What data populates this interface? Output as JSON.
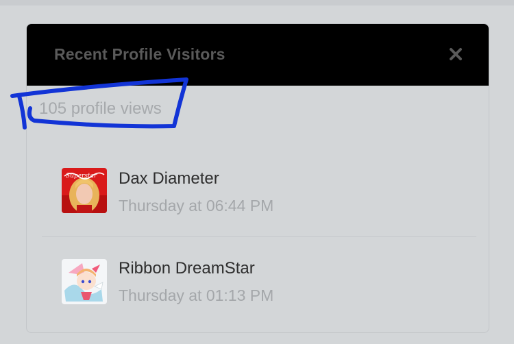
{
  "panel": {
    "title": "Recent Profile Visitors",
    "close_glyph": "✖",
    "views_text": "105 profile views"
  },
  "visitors": [
    {
      "name": "Dax Diameter",
      "time": "Thursday at 06:44 PM",
      "avatar_text": "Superstar",
      "avatar_icon": "superstar-album-cover"
    },
    {
      "name": "Ribbon DreamStar",
      "time": "Thursday at 01:13 PM",
      "avatar_icon": "anime-character-avatar"
    }
  ],
  "colors": {
    "page_bg": "#d3d6d8",
    "header_bg": "#000000",
    "title_color": "#5a5a5a",
    "muted_text": "#a4a7aa",
    "name_text": "#2e2e2e",
    "annotation_ink": "#1234d6"
  }
}
